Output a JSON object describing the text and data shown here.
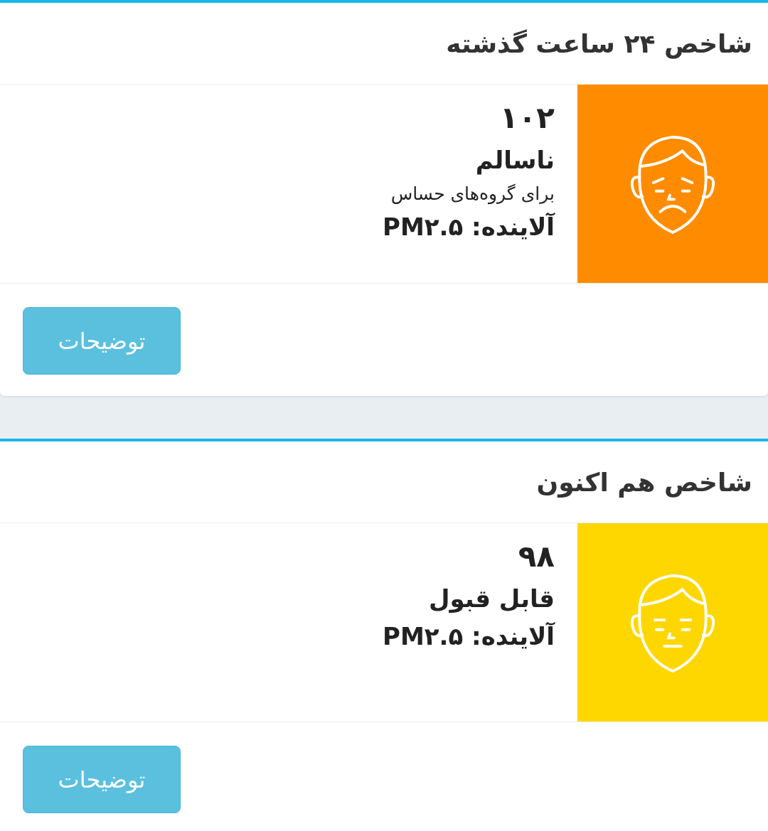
{
  "cards": [
    {
      "title": "شاخص ۲۴ ساعت گذشته",
      "index": "۱۰۲",
      "status": "ناسالم",
      "note": "برای گروه‌های حساس",
      "pollutant": "آلاینده: PM۲.۵",
      "color": "#ff8c00",
      "kind": "sad",
      "button": "توضیحات"
    },
    {
      "title": "شاخص هم اکنون",
      "index": "۹۸",
      "status": "قابل قبول",
      "pollutant": "آلاینده: PM۲.۵",
      "color": "#ffd700",
      "kind": "neutral",
      "button": "توضیحات"
    }
  ]
}
